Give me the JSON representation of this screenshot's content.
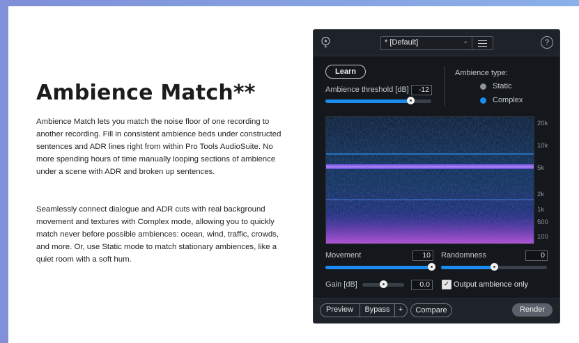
{
  "page": {
    "title": "Ambience Match**",
    "paragraph1": "Ambience Match lets you match the noise floor of one recording to another recording. Fill in consistent ambience beds under constructed sentences and ADR lines right from within Pro Tools AudioSuite. No more spending hours of time manually looping sections of ambience under a scene with ADR and broken up sentences.",
    "paragraph2": "Seamlessly connect dialogue and ADR cuts with real background movement and textures with Complex mode, allowing you to quickly match never before possible ambiences: ocean, wind, traffic, crowds, and more. Or, use Static mode to match stationary ambiences, like a quiet room with a soft hum."
  },
  "plugin": {
    "header": {
      "preset": "* [Default]",
      "help": "?",
      "icons": [
        "bulb-icon",
        "chevron-down-icon",
        "hamburger-menu-icon",
        "help-icon"
      ]
    },
    "learn_label": "Learn",
    "threshold": {
      "label": "Ambience threshold [dB]",
      "value": "-12",
      "level": 0.8
    },
    "ambience_type": {
      "label": "Ambience type:",
      "options": [
        {
          "label": "Static",
          "selected": false
        },
        {
          "label": "Complex",
          "selected": true
        }
      ]
    },
    "frequency_labels": [
      "20k",
      "10k",
      "5k",
      "2k",
      "1k",
      "500",
      "100"
    ],
    "movement": {
      "label": "Movement",
      "value": "10",
      "level": 1.0
    },
    "randomness": {
      "label": "Randomness",
      "value": "0",
      "level": 0.5
    },
    "gain": {
      "label": "Gain [dB]",
      "value": "0.0",
      "level": 0.5
    },
    "output_ambience_only": {
      "label": "Output ambience only",
      "checked": true,
      "checkmark": "✓"
    },
    "footer": {
      "preview": "Preview",
      "bypass": "Bypass",
      "plus": "+",
      "compare": "Compare",
      "render": "Render"
    },
    "colors": {
      "accent": "#1a8cf0",
      "panel": "#14181d",
      "header": "#1e232a"
    }
  }
}
